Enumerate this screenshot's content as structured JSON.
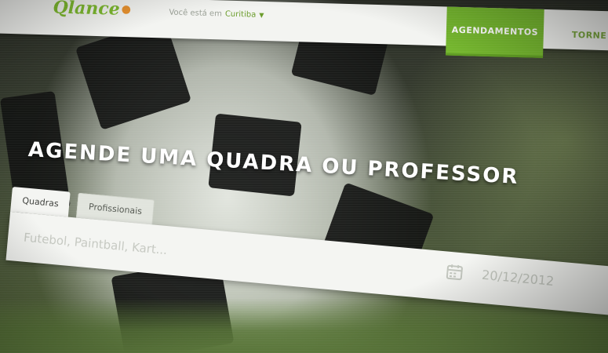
{
  "logo": {
    "text": "Qlance"
  },
  "header": {
    "location_prefix": "Você está em",
    "location_city": "Curitiba",
    "nav": [
      {
        "label": "AGENDAMENTOS",
        "active": true
      },
      {
        "label": "TORNE",
        "active": false
      }
    ]
  },
  "hero": {
    "headline": "AGENDE UMA QUADRA OU PROFESSOR"
  },
  "search": {
    "tabs": [
      {
        "label": "Quadras",
        "active": true
      },
      {
        "label": "Profissionais",
        "active": false
      }
    ],
    "placeholder": "Futebol, Paintball, Kart...",
    "date": "20/12/2012"
  },
  "colors": {
    "brand_green": "#74b62e",
    "logo_accent": "#e8912d",
    "nav_bg": "#f3f4f1",
    "panel_bg": "#f4f5f2"
  },
  "icons": [
    "logo-ball-icon",
    "caret-down-icon",
    "calendar-icon"
  ]
}
